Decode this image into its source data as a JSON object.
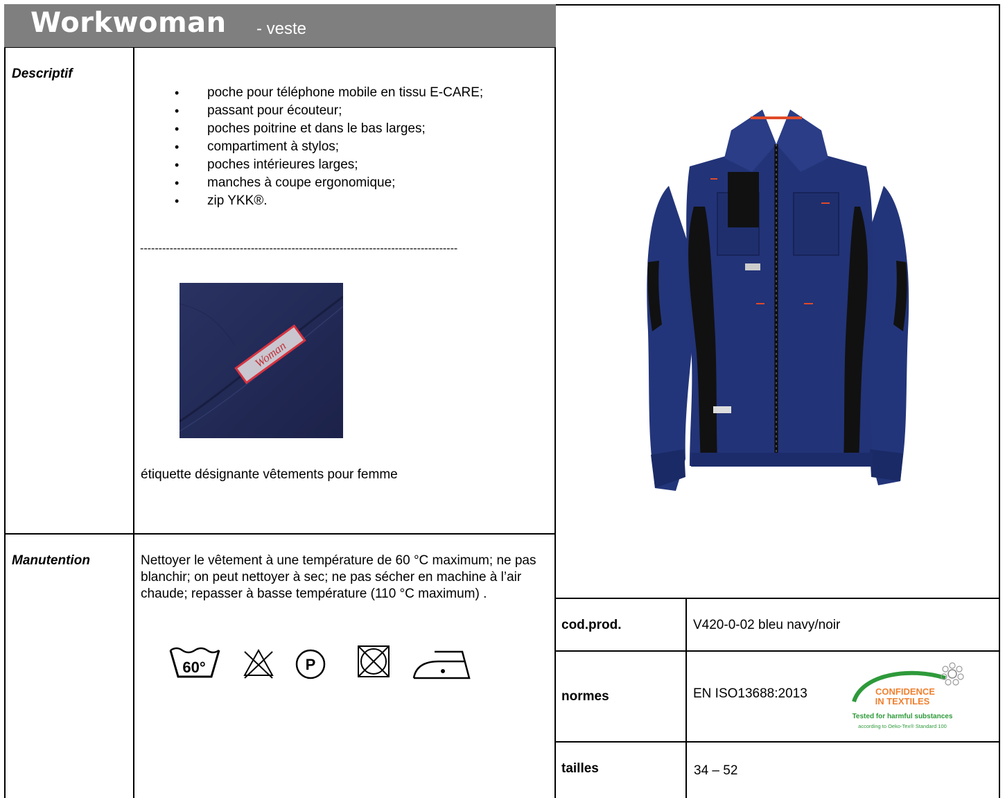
{
  "header": {
    "title": "Workwoman",
    "subtitle": "- veste"
  },
  "description": {
    "label": "Descriptif",
    "features": [
      "poche pour téléphone mobile en tissu E-CARE;",
      "passant pour écouteur;",
      "poches poitrine et dans le bas larges;",
      "compartiment à stylos;",
      "poches intérieures larges;",
      "manches à coupe ergonomique;",
      "zip YKK®."
    ],
    "separator": "--------------------------------------------------------------------------------------",
    "label_image_text": "Woman",
    "label_caption": "étiquette désignante vêtements pour femme"
  },
  "care": {
    "label": "Manutention",
    "text": "Nettoyer le vêtement à une température de 60 °C maximum; ne pas blanchir; on peut nettoyer à sec; ne pas sécher en machine à l’air chaude;      repasser à basse température (110 °C maximum) .",
    "wash_temp": "60°",
    "dryclean_letter": "P",
    "icons": [
      "wash-60-icon",
      "no-bleach-icon",
      "dry-clean-p-icon",
      "no-tumble-dry-icon",
      "iron-low-icon"
    ]
  },
  "specs": {
    "code_label": "cod.prod.",
    "code_value": "V420-0-02 bleu navy/noir",
    "norms_label": "normes",
    "norms_value": "EN ISO13688:2013",
    "sizes_label": "tailles",
    "sizes_value": "34 – 52"
  },
  "certification": {
    "line1": "CONFIDENCE",
    "line2": "IN TEXTILES",
    "line3": "Tested for harmful substances",
    "line4": "according to Oeko-Tex® Standard 100"
  },
  "colors": {
    "header_bg": "#7f7f7f",
    "jacket_navy": "#1f3170",
    "jacket_black": "#111111",
    "accent_red": "#e04a2a",
    "oeko_green": "#2e9a3a"
  }
}
